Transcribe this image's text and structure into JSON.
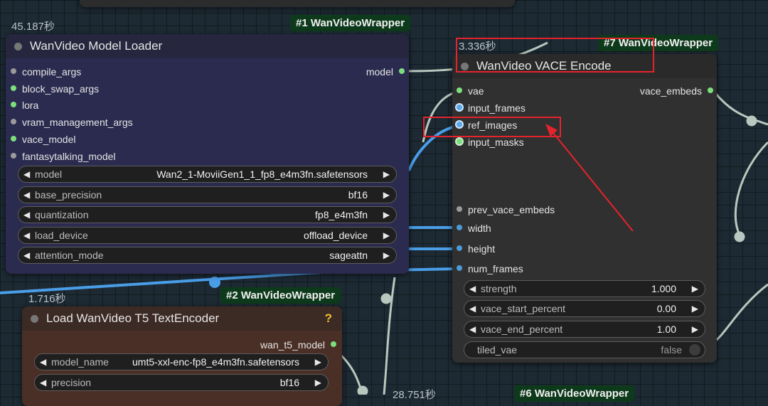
{
  "colors": {
    "canvas_bg": "#1d2a33",
    "badge_bg": "#0e3a1c",
    "loader_node_bg": "#2b2b50",
    "t5_node_bg": "#4a2f26",
    "vace_node_bg": "#303030",
    "annotation_red": "#e5232c",
    "link_blue": "#4a9ee8",
    "link_grey": "#b9c8be",
    "pin_green": "#7be07b",
    "pin_grey": "#9a9a9a",
    "pin_blue": "#4b9bd8"
  },
  "timings": {
    "loader": "45.187秒",
    "t5": "1.716秒",
    "vace": "3.336秒",
    "bottom": "28.751秒"
  },
  "badges": {
    "loader": "#1 WanVideoWrapper",
    "t5": "#2 WanVideoWrapper",
    "vace": "#7 WanVideoWrapper",
    "bottom": "#6 WanVideoWrapper"
  },
  "loader_node": {
    "title": "WanVideo Model Loader",
    "inputs": [
      "compile_args",
      "block_swap_args",
      "lora",
      "vram_management_args",
      "vace_model",
      "fantasytalking_model"
    ],
    "output": "model",
    "widgets": [
      {
        "label": "model",
        "value": "Wan2_1-MoviiGen1_1_fp8_e4m3fn.safetensors"
      },
      {
        "label": "base_precision",
        "value": "bf16"
      },
      {
        "label": "quantization",
        "value": "fp8_e4m3fn"
      },
      {
        "label": "load_device",
        "value": "offload_device"
      },
      {
        "label": "attention_mode",
        "value": "sageattn"
      }
    ]
  },
  "t5_node": {
    "title": "Load WanVideo T5 TextEncoder",
    "help": "?",
    "output": "wan_t5_model",
    "widgets": [
      {
        "label": "model_name",
        "value": "umt5-xxl-enc-fp8_e4m3fn.safetensors"
      },
      {
        "label": "precision",
        "value": "bf16"
      }
    ]
  },
  "vace_node": {
    "title": "WanVideo VACE Encode",
    "inputs": [
      "vae",
      "input_frames",
      "ref_images",
      "input_masks",
      "prev_vace_embeds",
      "width",
      "height",
      "num_frames"
    ],
    "output": "vace_embeds",
    "widgets": [
      {
        "label": "strength",
        "value": "1.000"
      },
      {
        "label": "vace_start_percent",
        "value": "0.00"
      },
      {
        "label": "vace_end_percent",
        "value": "1.00"
      }
    ],
    "toggle": {
      "label": "tiled_vae",
      "value": "false"
    }
  },
  "arrows": {
    "left": "◀",
    "right": "▶"
  }
}
